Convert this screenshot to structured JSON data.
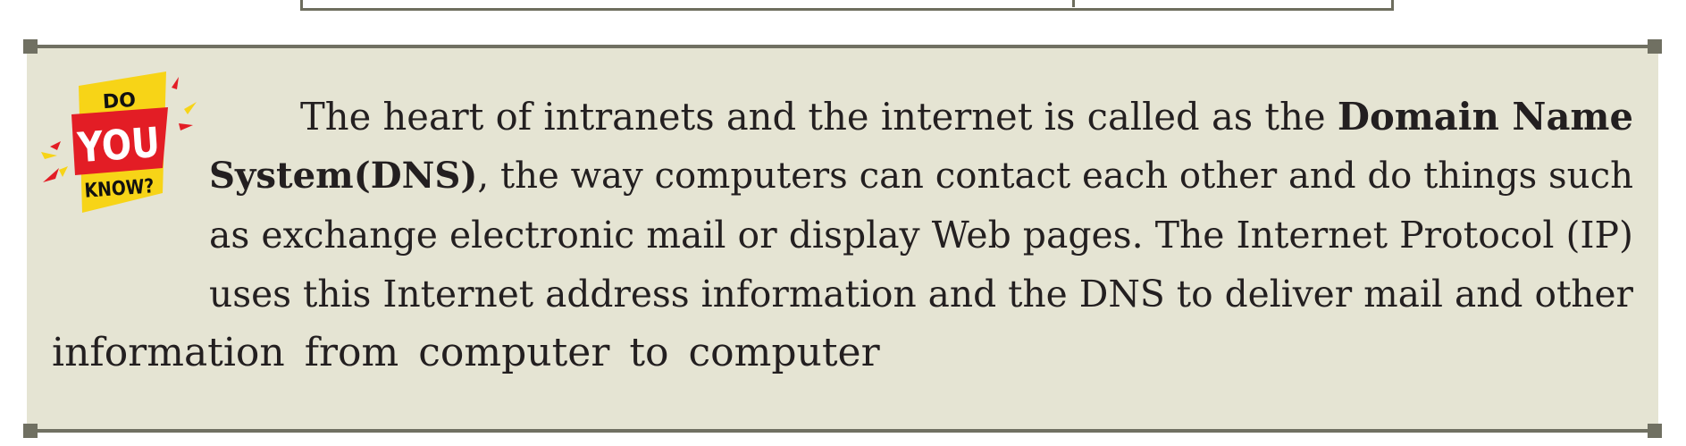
{
  "badge": {
    "line1": "DO",
    "line2": "YOU",
    "line3": "KNOW?",
    "colors": {
      "yellow": "#f7d417",
      "red": "#e31d25",
      "black": "#111111"
    }
  },
  "paragraph": {
    "line1_text": "The heart of intranets and the internet is called as the",
    "line1_bold": "Domain Name",
    "line2_bold": "System(DNS)",
    "line2_text": ", the way computers can contact each other and do things such",
    "line3_text": "as exchange electronic mail or display Web pages. The Internet Protocol (IP)",
    "line4_text": "uses this Internet address information and the DNS to deliver mail and other",
    "line5_text": "information from computer  to computer"
  },
  "colors": {
    "box_background": "#e5e4d3",
    "border": "#707062",
    "text": "#231f20"
  }
}
